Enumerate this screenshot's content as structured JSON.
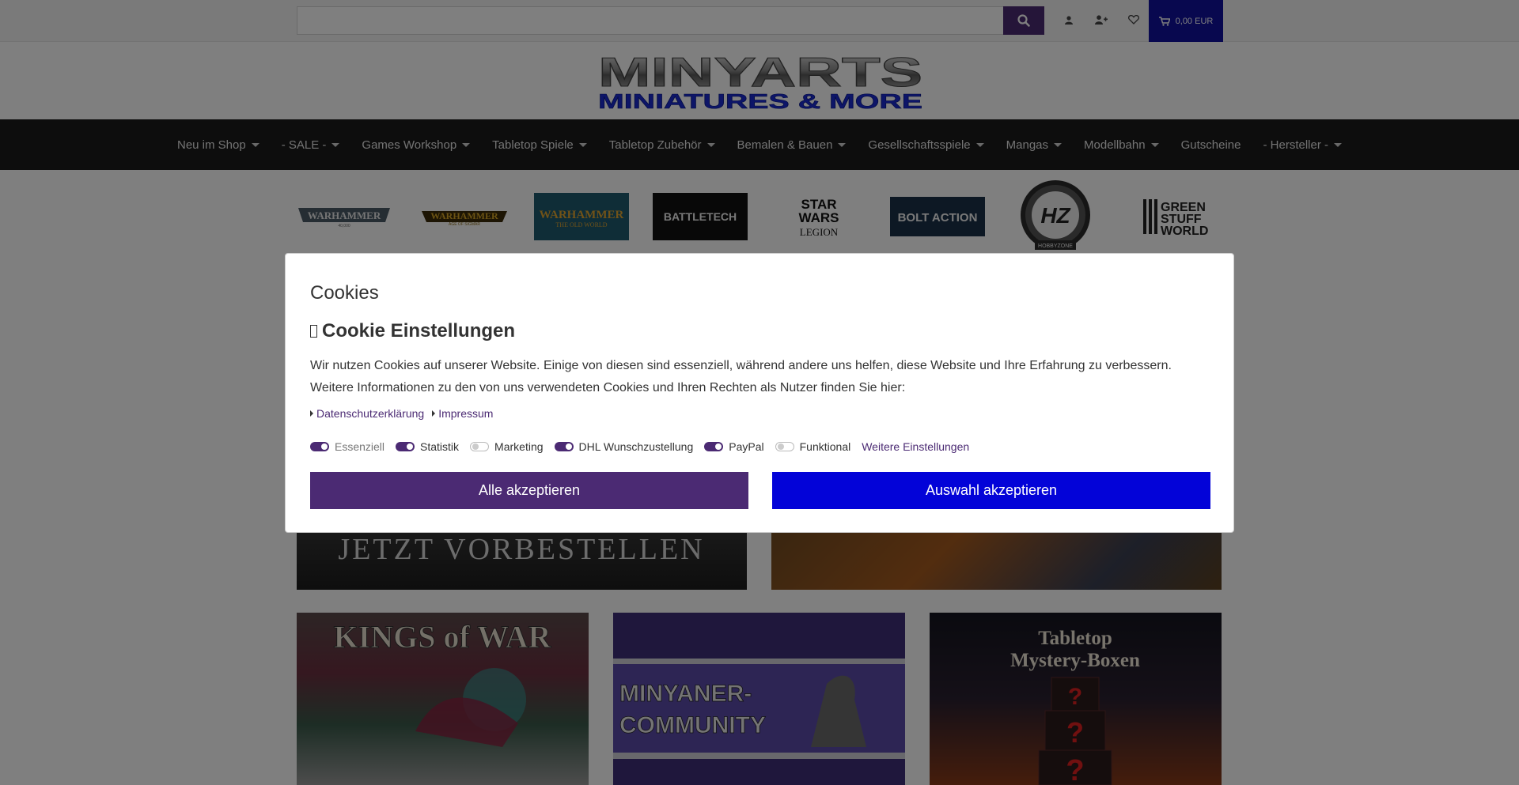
{
  "search": {
    "placeholder": ""
  },
  "cart": {
    "amount": "0,00 EUR"
  },
  "logo": {
    "line1": "MINYARTS",
    "line2": "MINIATURES & MORE"
  },
  "nav": {
    "items": [
      {
        "label": "Neu im Shop",
        "dropdown": true
      },
      {
        "label": "- SALE -",
        "dropdown": true
      },
      {
        "label": "Games Workshop",
        "dropdown": true
      },
      {
        "label": "Tabletop Spiele",
        "dropdown": true
      },
      {
        "label": "Tabletop Zubehör",
        "dropdown": true
      },
      {
        "label": "Bemalen & Bauen",
        "dropdown": true
      },
      {
        "label": "Gesellschaftsspiele",
        "dropdown": true
      },
      {
        "label": "Mangas",
        "dropdown": true
      },
      {
        "label": "Modellbahn",
        "dropdown": true
      },
      {
        "label": "Gutscheine",
        "dropdown": false
      },
      {
        "label": "- Hersteller -",
        "dropdown": true
      }
    ]
  },
  "brands": {
    "wh40k": "WARHAMMER",
    "wh40k_sub": "40,000",
    "aos": "WARHAMMER",
    "aos_sub": "AGE OF SIGMAR",
    "oldworld": "WARHAMMER",
    "oldworld_sub": "THE OLD WORLD",
    "battletech": "BATTLETECH",
    "starwars_1": "STAR",
    "starwars_2": "WARS",
    "starwars_3": "LEGION",
    "boltaction": "BOLT ACTION",
    "hobbyzone": "HOBBYZONE",
    "greenstuff_1": "GREEN",
    "greenstuff_2": "STUFF",
    "greenstuff_3": "WORLD"
  },
  "banners": {
    "preorder": "JETZT VORBESTELLEN",
    "kingsofwar": "KINGS of WAR",
    "community_1": "MINYANER-",
    "community_2": "COMMUNITY",
    "mystery_1": "Tabletop",
    "mystery_2": "Mystery-Boxen",
    "qmark": "?"
  },
  "cookie": {
    "title": "Cookies",
    "subtitle": "Cookie Einstellungen",
    "text": "Wir nutzen Cookies auf unserer Website. Einige von diesen sind essenziell, während andere uns helfen, diese Website und Ihre Erfahrung zu verbessern. Weitere Informationen zu den von uns verwendeten Cookies und Ihren Rechten als Nutzer finden Sie hier:",
    "link_privacy": "Datenschutzerklärung",
    "link_imprint": "Impressum",
    "toggles": [
      {
        "label": "Essenziell",
        "on": true
      },
      {
        "label": "Statistik",
        "on": true
      },
      {
        "label": "Marketing",
        "on": false
      },
      {
        "label": "DHL Wunschzustellung",
        "on": true
      },
      {
        "label": "PayPal",
        "on": true
      },
      {
        "label": "Funktional",
        "on": false
      }
    ],
    "more_settings": "Weitere Einstellungen",
    "accept_all": "Alle akzeptieren",
    "accept_selection": "Auswahl akzeptieren"
  },
  "colors": {
    "primary": "#4b2a73",
    "cart": "#10109f",
    "accept_selection": "#0303d8",
    "nav_bg": "#1a1a1a"
  }
}
